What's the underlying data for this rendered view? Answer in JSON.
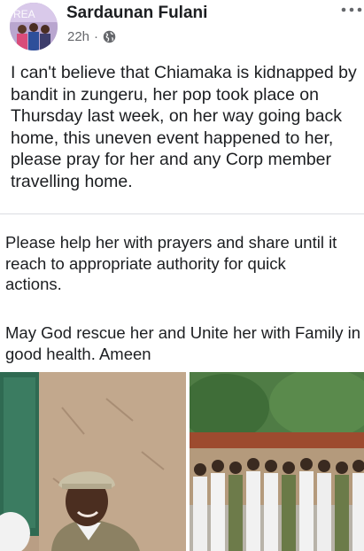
{
  "post": {
    "author": "Sardaunan Fulani",
    "time": "22h",
    "separator": "·",
    "privacy_icon": "globe-icon",
    "more_icon": "more-options-icon",
    "avatar_caption": "REA"
  },
  "content": {
    "paragraph1": "I can't believe that Chiamaka is kidnapped by bandit in zungeru, her pop took place on Thursday last week, on her way going back home, this uneven event happened to her, please pray for her and any Corp member travelling home.",
    "paragraph2_lines": [
      "Please help her with prayers and share until it",
      "reach to appropriate authority for quick",
      "actions."
    ],
    "paragraph3": "May God rescue her and Unite her with Family in good health. Ameen"
  },
  "photos": [
    {
      "name": "portrait-photo"
    },
    {
      "name": "group-photo"
    }
  ],
  "colors": {
    "text": "#1c1e21",
    "meta": "#65676b",
    "divider": "#dadde1"
  }
}
